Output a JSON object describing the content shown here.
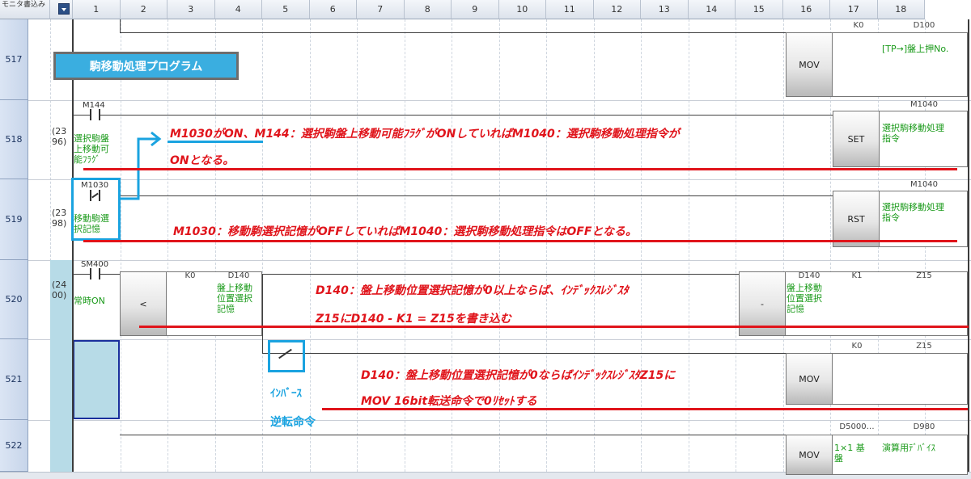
{
  "header": {
    "first_col": "モニタ書込み",
    "columns": [
      "1",
      "2",
      "3",
      "4",
      "5",
      "6",
      "7",
      "8",
      "9",
      "10",
      "11",
      "12",
      "13",
      "14",
      "15",
      "16",
      "17",
      "18"
    ]
  },
  "rows": [
    "517",
    "518",
    "519",
    "520",
    "521",
    "522"
  ],
  "title_box": "駒移動処理プログラム",
  "steps": {
    "r518": "(23\n96)",
    "r519": "(23\n98)",
    "r520": "(24\n00)"
  },
  "contacts": {
    "m144": "M144",
    "m1030": "M1030",
    "sm400": "SM400"
  },
  "comments": {
    "m144": "選択駒盤\n上移動可\n能ﾌﾗｸﾞ",
    "m1030": "移動駒選\n択記憶",
    "sm400": "常時ON"
  },
  "instructions": {
    "r517_mov": "MOV",
    "r517_src": "K0",
    "r517_dst": "D100",
    "r517_dst_comment": "[TP→]盤上押No.",
    "r518_set": "SET",
    "r518_dev": "M1040",
    "r518_dev_comment": "選択駒移動処理\n指令",
    "r519_rst": "RST",
    "r519_dev": "M1040",
    "r519_dev_comment": "選択駒移動処理\n指令",
    "r520_cmp": "<",
    "r520_k": "K0",
    "r520_d": "D140",
    "r520_d_comment": "盤上移動\n位置選択\n記憶",
    "r520_sub": "-",
    "r520_sub_s1": "D140",
    "r520_sub_s1_comment": "盤上移動\n位置選択\n記憶",
    "r520_sub_s2": "K1",
    "r520_sub_dst": "Z15",
    "r521_mov": "MOV",
    "r521_src": "K0",
    "r521_dst": "Z15",
    "r522_mov": "MOV",
    "r522_src": "D5000…",
    "r522_src_comment": "1×1 基\n盤",
    "r522_dst": "D980",
    "r522_dst_comment": "演算用ﾃﾞﾊﾞｲｽ"
  },
  "notes": {
    "note1_a": "M1030がON、M144：選択駒盤上移動可能ﾌﾗｸﾞがONしていればM1040：選択駒移動処理指令が",
    "note1_b": "ONとなる。",
    "note2": "M1030：移動駒選択記憶がOFFしていればM1040：選択駒移動処理指令はOFFとなる。",
    "note3_a": "D140：盤上移動位置選択記憶が0以上ならば、ｲﾝﾃﾞｯｸｽﾚｼﾞｽﾀ",
    "note3_b": "Z15にD140 - K1 = Z15を書き込む",
    "note4_a": "D140：盤上移動位置選択記憶が0ならばｲﾝﾃﾞｯｸｽﾚｼﾞｽﾀZ15に",
    "note4_b": "MOV 16bit転送命令で0ﾘｾｯﾄする",
    "inverse": "ｲﾝﾊﾞｰｽ",
    "inverse_jp": "逆転命令"
  },
  "colors": {
    "note_red": "#e0141b",
    "highlight_blue": "#1aa3e0",
    "comment_green": "#1a9a1a"
  }
}
